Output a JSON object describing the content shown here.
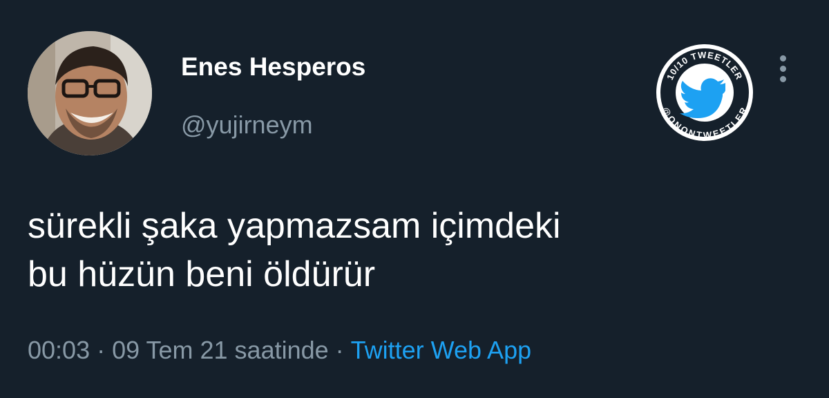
{
  "author": {
    "display_name": "Enes Hesperos",
    "handle": "@yujirneym"
  },
  "badge": {
    "top_text": "10/10 TWEETLER",
    "bottom_text": "@ONONTWEETLER",
    "icon": "twitter-bird-icon",
    "color": "#1da1f2"
  },
  "menu": {
    "icon": "more-vertical-icon"
  },
  "tweet": {
    "text": "sürekli şaka yapmazsam içimdeki\nbu hüzün beni öldürür"
  },
  "meta": {
    "time": "00:03",
    "separator": "·",
    "date": "09 Tem 21 saatinde",
    "source": "Twitter Web App"
  },
  "colors": {
    "background": "#15202b",
    "secondary_text": "#8899a6",
    "link": "#1da1f2"
  }
}
